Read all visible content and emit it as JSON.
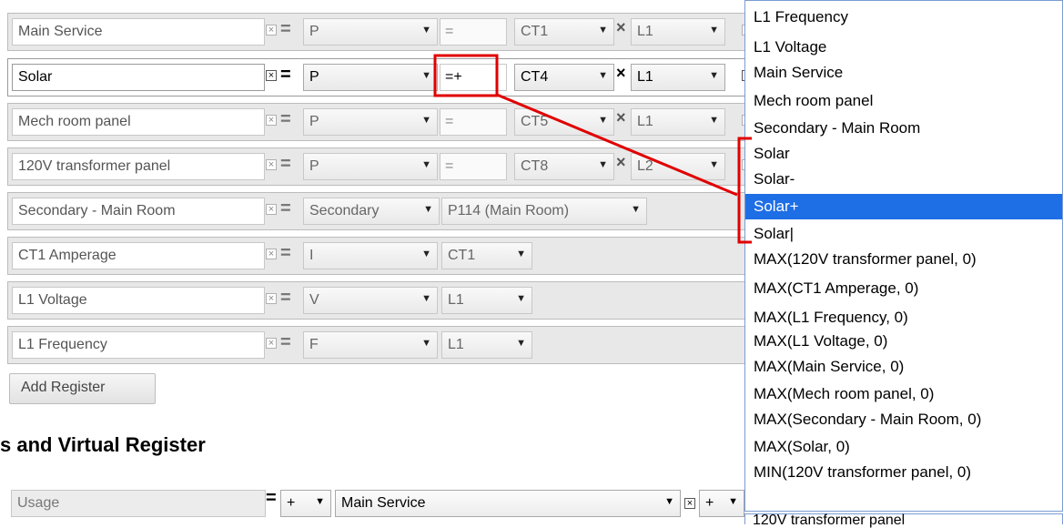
{
  "rows": [
    {
      "name": "Main Service",
      "type": "P",
      "op": "=",
      "ct": "CT1",
      "line": "L1",
      "state": "inactive"
    },
    {
      "name": "Solar",
      "type": "P",
      "op": "=+",
      "ct": "CT4",
      "line": "L1",
      "state": "active"
    },
    {
      "name": "Mech room panel",
      "type": "P",
      "op": "=",
      "ct": "CT5",
      "line": "L1",
      "state": "inactive"
    },
    {
      "name": "120V transformer panel",
      "type": "P",
      "op": "=",
      "ct": "CT8",
      "line": "L2",
      "state": "inactive"
    },
    {
      "name": "Secondary - Main Room",
      "type": "Secondary",
      "source": "P114 (Main Room)",
      "state": "inactive"
    },
    {
      "name": "CT1 Amperage",
      "type": "I",
      "ct": "CT1",
      "state": "inactive"
    },
    {
      "name": "L1 Voltage",
      "type": "V",
      "line": "L1",
      "state": "inactive"
    },
    {
      "name": "L1 Frequency",
      "type": "F",
      "line": "L1",
      "state": "inactive"
    }
  ],
  "symbols": {
    "equals": "=",
    "remove": "×",
    "times": "×",
    "caret": "▼"
  },
  "add_register_label": "Add Register",
  "section_heading": "s and Virtual Register",
  "bottom_row": {
    "name": "Usage",
    "operator": "+",
    "register": "Main Service",
    "operator2": "+",
    "selected_register": "120V transformer panel"
  },
  "dropdown": {
    "options": [
      "L1 Frequency",
      "L1 Voltage",
      "Main Service",
      "Mech room panel",
      "Secondary - Main Room",
      "Solar",
      "Solar-",
      "Solar+",
      "Solar|",
      "MAX(120V transformer panel, 0)",
      "MAX(CT1 Amperage, 0)",
      "MAX(L1 Frequency, 0)",
      "MAX(L1 Voltage, 0)",
      "MAX(Main Service, 0)",
      "MAX(Mech room panel, 0)",
      "MAX(Secondary - Main Room, 0)",
      "MAX(Solar, 0)",
      "MIN(120V transformer panel, 0)"
    ],
    "highlighted": "Solar+"
  },
  "annotation_color": "#e00000"
}
